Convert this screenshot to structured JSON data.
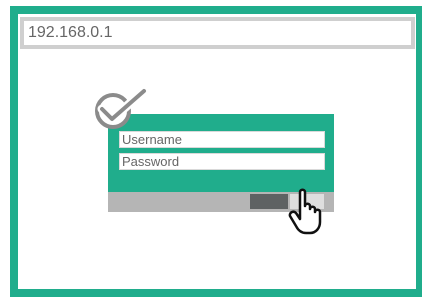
{
  "browser": {
    "address": "192.168.0.1"
  },
  "login": {
    "username_placeholder": "Username",
    "password_placeholder": "Password"
  },
  "icons": {
    "badge": "check-badge-icon",
    "cursor": "hand-pointer-icon"
  },
  "colors": {
    "accent": "#20ad8c",
    "footer": "#b5b5b5",
    "dark_button": "#5e6263",
    "light_button": "#dedede",
    "address_border": "#cfcfcf"
  }
}
